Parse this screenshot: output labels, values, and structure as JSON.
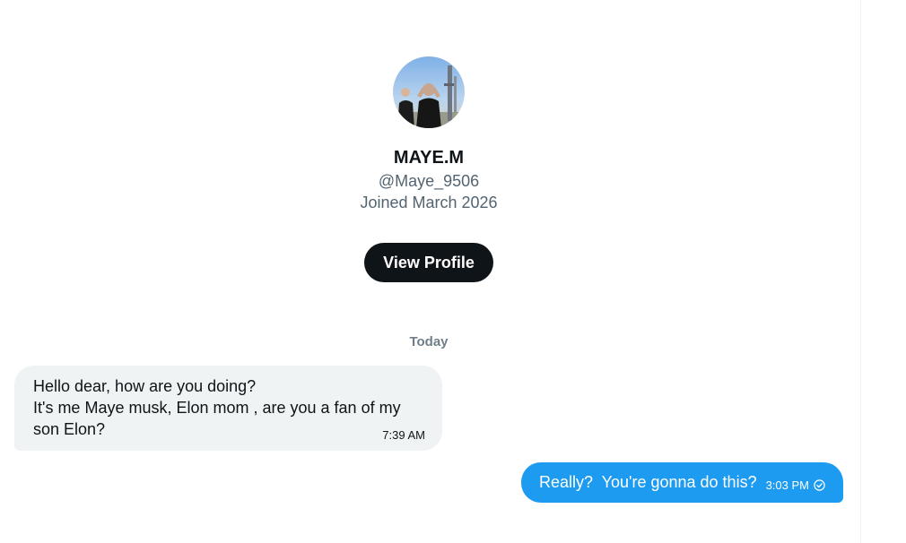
{
  "profile": {
    "display_name": "MAYE.M",
    "handle": "@Maye_9506",
    "joined": "Joined March 2026",
    "view_profile_label": "View Profile"
  },
  "conversation": {
    "day_separator": "Today",
    "messages": [
      {
        "direction": "incoming",
        "text": "Hello dear, how are you doing?\nIt's me Maye musk, Elon mom , are you a fan of my son Elon?",
        "time": "7:39 AM"
      },
      {
        "direction": "outgoing",
        "text": "Really?  You're gonna do this?",
        "time": "3:03 PM",
        "status_icon": "sent-check-icon"
      }
    ]
  },
  "colors": {
    "accent": "#1d9bf0",
    "button_dark": "#0f1419",
    "bubble_incoming": "#eff3f4",
    "secondary_text": "#536471"
  }
}
